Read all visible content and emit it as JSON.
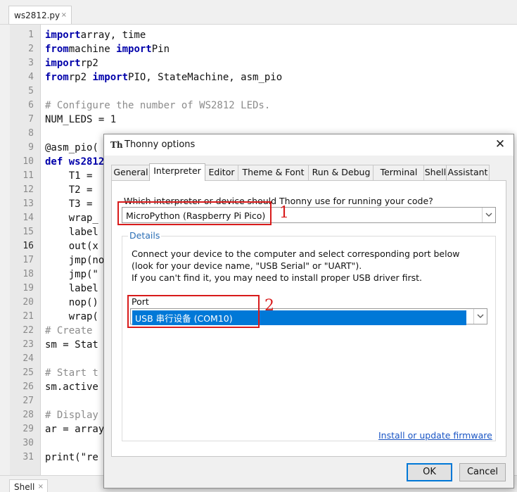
{
  "editor": {
    "file_tab": "ws2812.py",
    "tab_close": "×",
    "line_numbers": [
      "1",
      "2",
      "3",
      "4",
      "5",
      "6",
      "7",
      "8",
      "9",
      "10",
      "11",
      "12",
      "13",
      "14",
      "15",
      "16",
      "17",
      "18",
      "19",
      "20",
      "21",
      "22",
      "23",
      "24",
      "25",
      "26",
      "27",
      "28",
      "29",
      "30",
      "31"
    ],
    "current_line": "16",
    "lines": [
      [
        [
          "kw",
          "import"
        ],
        [
          "",
          "array, time"
        ]
      ],
      [
        [
          "kw",
          "from"
        ],
        [
          "",
          "machine "
        ],
        [
          "kw",
          "import"
        ],
        [
          "",
          "Pin"
        ]
      ],
      [
        [
          "kw",
          "import"
        ],
        [
          "",
          "rp2"
        ]
      ],
      [
        [
          "kw",
          "from"
        ],
        [
          "",
          "rp2 "
        ],
        [
          "kw",
          "import"
        ],
        [
          "",
          "PIO, StateMachine, asm_pio"
        ]
      ],
      [],
      [
        [
          "cmt",
          "# Configure the number of WS2812 LEDs."
        ]
      ],
      [
        [
          "",
          "NUM_LEDS = "
        ],
        [
          "num",
          "1"
        ]
      ],
      [],
      [
        [
          "",
          "@asm_pio("
        ]
      ],
      [
        [
          "kw",
          "def"
        ],
        [
          "",
          ""
        ],
        [
          "kw",
          " ws2812"
        ]
      ],
      [
        [
          "",
          "    T1 = "
        ]
      ],
      [
        [
          "",
          "    T2 = "
        ]
      ],
      [
        [
          "",
          "    T3 = "
        ]
      ],
      [
        [
          "",
          "    wrap_"
        ]
      ],
      [
        [
          "",
          "    label"
        ]
      ],
      [
        [
          "",
          "    out(x"
        ]
      ],
      [
        [
          "",
          "    jmp(no"
        ]
      ],
      [
        [
          "",
          "    jmp(\""
        ]
      ],
      [
        [
          "",
          "    label"
        ]
      ],
      [
        [
          "",
          "    nop()"
        ]
      ],
      [
        [
          "",
          "    wrap("
        ]
      ],
      [
        [
          "cmt",
          "# Create "
        ]
      ],
      [
        [
          "",
          "sm = Stat"
        ]
      ],
      [],
      [
        [
          "cmt",
          "# Start t"
        ]
      ],
      [
        [
          "",
          "sm.active"
        ]
      ],
      [],
      [
        [
          "cmt",
          "# Display"
        ]
      ],
      [
        [
          "",
          "ar = array"
        ]
      ],
      [],
      [
        [
          "",
          "print(\"re"
        ]
      ]
    ]
  },
  "shell_tab": {
    "label": "Shell",
    "close": "×"
  },
  "dialog": {
    "title": "Thonny options",
    "close_symbol": "✕",
    "tabs": [
      "General",
      "Interpreter",
      "Editor",
      "Theme & Font",
      "Run & Debug",
      "Terminal",
      "Shell",
      "Assistant"
    ],
    "active_tab": "Interpreter",
    "interpreter_question": "Which interpreter or device should Thonny use for running your code?",
    "interpreter_value": "MicroPython (Raspberry Pi Pico)",
    "details_legend": "Details",
    "details_lines": [
      "Connect your device to the computer and select corresponding port below",
      "(look for your device name, \"USB Serial\" or \"UART\").",
      "If you can't find it, you may need to install proper USB driver first."
    ],
    "port_label": "Port",
    "port_value": "USB 串行设备 (COM10)",
    "firmware_link": "Install or update firmware",
    "ok_label": "OK",
    "cancel_label": "Cancel"
  },
  "annotations": {
    "marker_1": "1",
    "marker_2": "2",
    "color": "#d81b1b"
  },
  "colors": {
    "keyword": "#0000aa",
    "comment": "#8c8c8c",
    "selection": "#0078d7",
    "link": "#1a55c4"
  }
}
